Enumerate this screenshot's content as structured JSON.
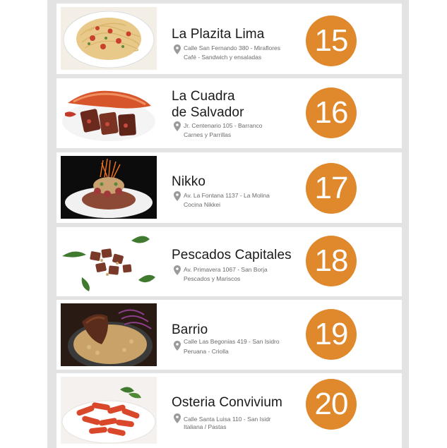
{
  "restaurants": [
    {
      "name_lines": [
        "La Plazita Lima",
        ""
      ],
      "address": "Calle San Fernando 380 - Miraflores",
      "category": "Café - Sandwich y ensaladas",
      "rank": "15",
      "photo": "pasta-icon"
    },
    {
      "name_lines": [
        "La Cuadra",
        "de Salvador"
      ],
      "address": "Jr. Centenario 105 - Barranco",
      "category": "Carnes y Parrillas",
      "rank": "16",
      "photo": "grill-icon"
    },
    {
      "name_lines": [
        "Nikko",
        ""
      ],
      "address": "Av. La Fontana 1137 - La Molina",
      "category": "Cocina Nikkei",
      "rank": "17",
      "photo": "nikkei-dish-icon"
    },
    {
      "name_lines": [
        "Pescados Capitales",
        ""
      ],
      "address": "Av. Primavera 1067 - San Borja",
      "category": "Pescados y Mariscos",
      "rank": "18",
      "photo": "seafood-icon"
    },
    {
      "name_lines": [
        "Barrio",
        ""
      ],
      "address": "Calle Las Begonias 419 - San Isidro",
      "category": "Peruana - Criolla",
      "rank": "19",
      "photo": "criolla-dish-icon"
    },
    {
      "name_lines": [
        "Osteria Convivium",
        ""
      ],
      "address": "Calle Santa Luisa 110 - San Isidr",
      "category": "Italiana / Pastas",
      "rank": "20",
      "photo": "penne-icon"
    }
  ],
  "colors": {
    "badge": "#e0882c",
    "background_strip": "#e3e3e3",
    "card": "#ffffff"
  }
}
